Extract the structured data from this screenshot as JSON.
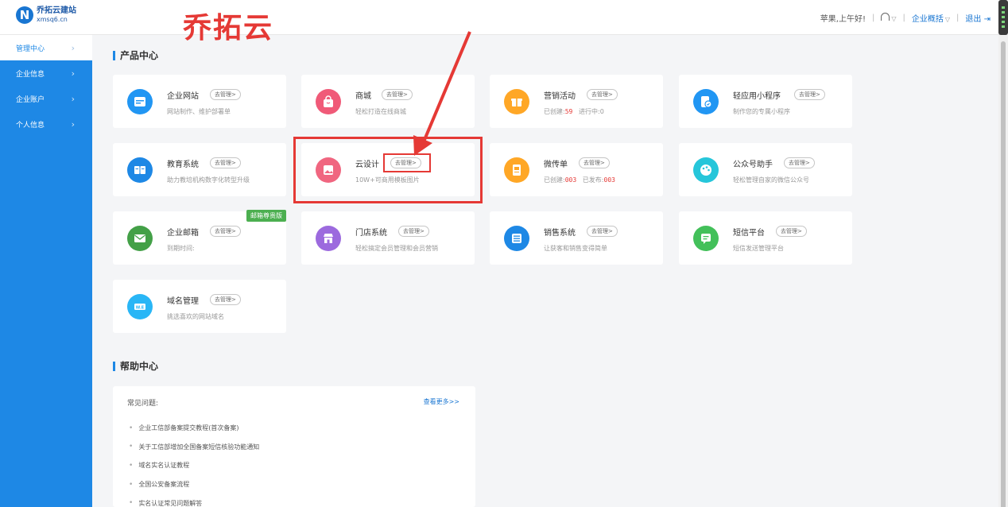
{
  "header": {
    "logo_name": "乔拓云建站",
    "logo_domain": "xmsq6.cn",
    "annotation_title": "乔拓云",
    "greeting": "苹果,上午好!",
    "enterprise_menu": "企业概括",
    "logout": "退出"
  },
  "sidebar": {
    "items": [
      {
        "label": "管理中心"
      },
      {
        "label": "企业信息"
      },
      {
        "label": "企业账户"
      },
      {
        "label": "个人信息"
      }
    ]
  },
  "products": {
    "section_title": "产品中心",
    "go_label": "去管理>",
    "items": [
      {
        "name": "企业网站",
        "desc": "网站制作、维护部署单",
        "color": "#2196f3",
        "icon": "website-icon"
      },
      {
        "name": "商城",
        "desc": "轻松打造在线商城",
        "color": "#f05a78",
        "icon": "shop-bag-icon"
      },
      {
        "name": "营销活动",
        "desc_prefix": "已创建:",
        "desc_num1": "59",
        "desc_mid": "进行中:",
        "desc_num2": "0",
        "color": "#ffa726",
        "icon": "gift-icon"
      },
      {
        "name": "轻应用小程序",
        "desc": "制作您的专属小程序",
        "color": "#2196f3",
        "icon": "mini-program-icon"
      },
      {
        "name": "教育系统",
        "desc": "助力教培机构数字化转型升级",
        "color": "#1e88e5",
        "icon": "book-icon"
      },
      {
        "name": "云设计",
        "desc": "10W+可商用模板图片",
        "color": "#f06680",
        "icon": "image-icon"
      },
      {
        "name": "微传单",
        "desc_prefix": "已创建:",
        "desc_num1": "003",
        "desc_mid": "已发布:",
        "desc_num2": "003",
        "color": "#ffa726",
        "icon": "flyer-icon"
      },
      {
        "name": "公众号助手",
        "desc": "轻松管理自家的微信公众号",
        "color": "#26c6da",
        "icon": "palette-icon"
      },
      {
        "name": "企业邮箱",
        "desc": "到期时间:",
        "color": "#43a047",
        "icon": "mail-icon",
        "ribbon": "邮箱尊贵版"
      },
      {
        "name": "门店系统",
        "desc": "轻松搞定会员管理和会员营销",
        "color": "#9c6ade",
        "icon": "store-icon"
      },
      {
        "name": "销售系统",
        "desc": "让获客和销售变得简单",
        "color": "#1e88e5",
        "icon": "list-icon"
      },
      {
        "name": "短信平台",
        "desc": "短信发送管理平台",
        "color": "#43c05a",
        "icon": "sms-icon"
      },
      {
        "name": "域名管理",
        "desc": "挑选喜欢的网站域名",
        "color": "#29b6f6",
        "icon": "domain-icon"
      }
    ]
  },
  "help": {
    "section_title": "帮助中心",
    "head": "常见问题:",
    "more": "查看更多>>",
    "items": [
      "企业工信部备案提交教程(首次备案)",
      "关于工信部增加全国备案短信核验功能通知",
      "域名实名认证教程",
      "全国公安备案流程",
      "实名认证常见问题解答"
    ]
  }
}
